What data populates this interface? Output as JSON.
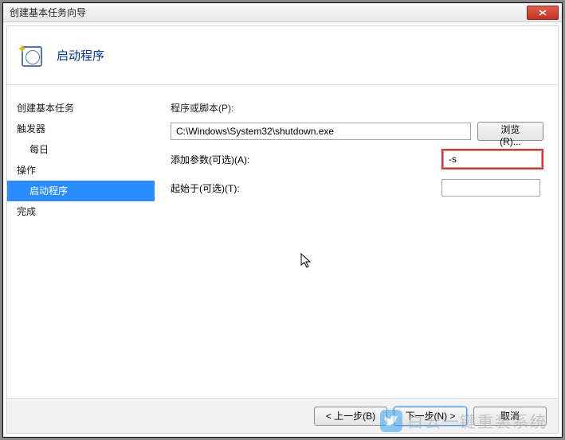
{
  "window": {
    "title": "创建基本任务向导"
  },
  "header": {
    "title": "启动程序"
  },
  "sidebar": {
    "items": [
      {
        "label": "创建基本任务",
        "indent": false,
        "selected": false
      },
      {
        "label": "触发器",
        "indent": false,
        "selected": false
      },
      {
        "label": "每日",
        "indent": true,
        "selected": false
      },
      {
        "label": "操作",
        "indent": false,
        "selected": false
      },
      {
        "label": "启动程序",
        "indent": true,
        "selected": true
      },
      {
        "label": "完成",
        "indent": false,
        "selected": false
      }
    ]
  },
  "form": {
    "program_label": "程序或脚本(P):",
    "program_value": "C:\\Windows\\System32\\shutdown.exe",
    "browse_label": "浏览(R)...",
    "args_label": "添加参数(可选)(A):",
    "args_value": "-s",
    "startin_label": "起始于(可选)(T):",
    "startin_value": ""
  },
  "footer": {
    "back": "< 上一步(B)",
    "next": "下一步(N) >",
    "cancel": "取消"
  },
  "watermark": {
    "text": "白云一键重装系统"
  }
}
